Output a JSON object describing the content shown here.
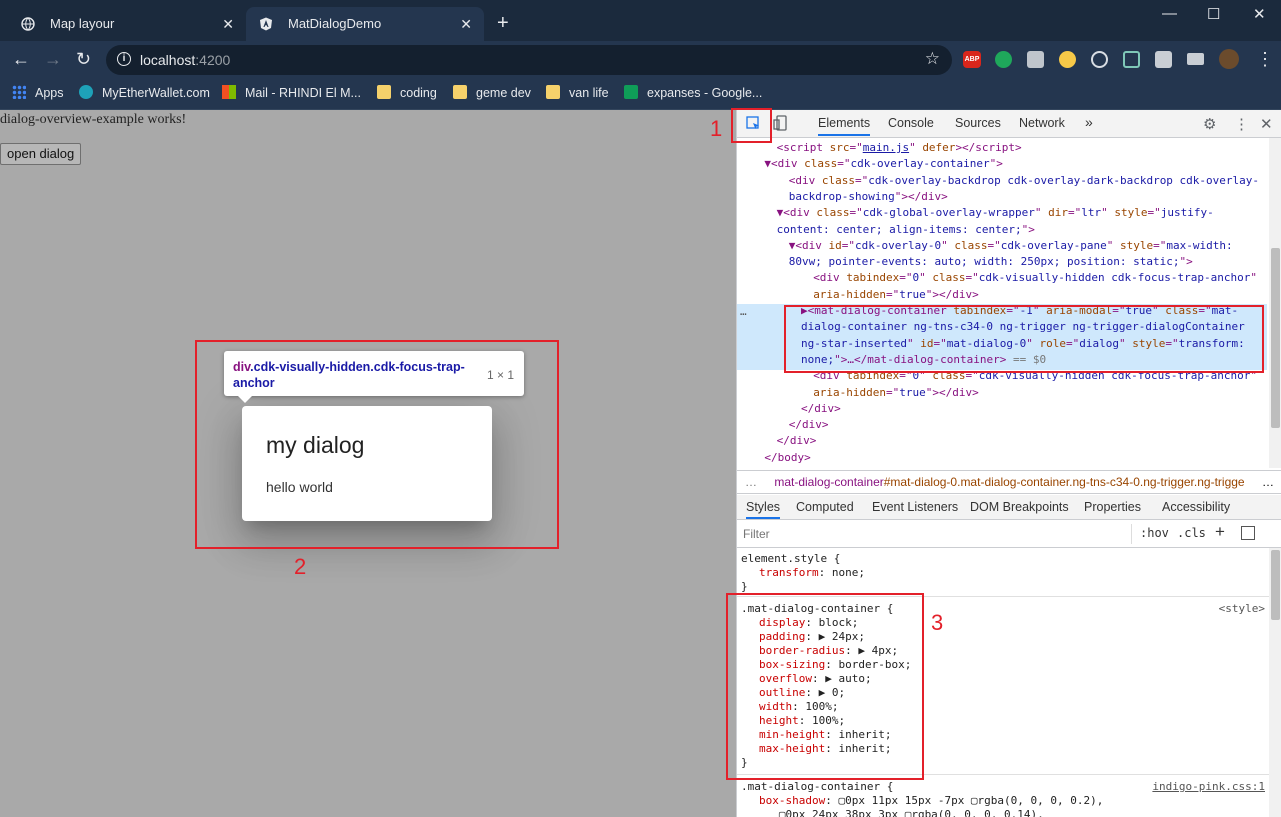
{
  "browser": {
    "tabs": [
      {
        "title": "Map layour",
        "close": "✕"
      },
      {
        "title": "MatDialogDemo",
        "close": "✕"
      }
    ],
    "new_tab": "+",
    "window_controls": {
      "minimize": "—",
      "maximize": "☐",
      "close": "✕"
    },
    "nav": {
      "back": "←",
      "forward": "→",
      "reload": "↻"
    },
    "url": {
      "host": "localhost",
      "port": ":4200"
    },
    "star": "☆",
    "extensions": [
      "adblock-plus",
      "green-leaf",
      "camera",
      "pacman",
      "target",
      "s-extension",
      "puzzle",
      "media",
      "avatar"
    ],
    "extension_label_abp": "ABP",
    "bookmarks": [
      {
        "label": "Apps",
        "icon": "apps-grid-icon"
      },
      {
        "label": "MyEtherWallet.com",
        "icon": "mew-icon"
      },
      {
        "label": "Mail - RHINDI El M...",
        "icon": "microsoft-icon"
      },
      {
        "label": "coding",
        "icon": "folder-icon"
      },
      {
        "label": "geme dev",
        "icon": "folder-icon"
      },
      {
        "label": "van life",
        "icon": "folder-icon"
      },
      {
        "label": "expanses - Google...",
        "icon": "sheets-icon"
      }
    ]
  },
  "page": {
    "works_text": "dialog-overview-example works!",
    "open_button": "open dialog",
    "tooltip": {
      "tag": "div",
      "classes": ".cdk-visually-hidden.cdk-focus-trap-anchor",
      "size": "1 × 1"
    },
    "dialog": {
      "title": "my dialog",
      "body": "hello world"
    }
  },
  "annotations": {
    "n1": "1",
    "n2": "2",
    "n3": "3",
    "color": "#e3202a"
  },
  "devtools": {
    "tabs": [
      "Elements",
      "Console",
      "Sources",
      "Network",
      "»"
    ],
    "dom": [
      {
        "indent": 3,
        "html": "<span class='tag'>&lt;script</span> <span class='an'>src</span>=\"<span class='lnk'>main.js</span>\" <span class='an'>defer</span><span class='tag'>&gt;&lt;/script&gt;</span>"
      },
      {
        "indent": 2,
        "html": "▼<span class='tag'>&lt;div</span> <span class='an'>class</span>=\"<span class='av'>cdk-overlay-container</span>\"<span class='tag'>&gt;</span>"
      },
      {
        "indent": 4,
        "html": "<span class='tag'>&lt;div</span> <span class='an'>class</span>=\"<span class='av'>cdk-overlay-backdrop cdk-overlay-dark-backdrop cdk-overlay-</span>"
      },
      {
        "indent": 4,
        "html": "<span class='av'>backdrop-showing</span>\"<span class='tag'>&gt;&lt;/div&gt;</span>"
      },
      {
        "indent": 3,
        "html": "▼<span class='tag'>&lt;div</span> <span class='an'>class</span>=\"<span class='av'>cdk-global-overlay-wrapper</span>\" <span class='an'>dir</span>=\"<span class='av'>ltr</span>\" <span class='an'>style</span>=\"<span class='av'>justify-</span>"
      },
      {
        "indent": 3,
        "html": "<span class='av'>content: center; align-items: center;</span>\"<span class='tag'>&gt;</span>"
      },
      {
        "indent": 4,
        "html": "▼<span class='tag'>&lt;div</span> <span class='an'>id</span>=\"<span class='av'>cdk-overlay-0</span>\" <span class='an'>class</span>=\"<span class='av'>cdk-overlay-pane</span>\" <span class='an'>style</span>=\"<span class='av'>max-width:</span>"
      },
      {
        "indent": 4,
        "html": "<span class='av'>80vw; pointer-events: auto; width: 250px; position: static;</span>\"<span class='tag'>&gt;</span>"
      },
      {
        "indent": 6,
        "html": "<span class='tag'>&lt;div</span> <span class='an'>tabindex</span>=\"<span class='av'>0</span>\" <span class='an'>class</span>=\"<span class='av'>cdk-visually-hidden cdk-focus-trap-anchor</span>\""
      },
      {
        "indent": 6,
        "html": "<span class='an'>aria-hidden</span>=\"<span class='av'>true</span>\"<span class='tag'>&gt;&lt;/div&gt;</span>"
      },
      {
        "indent": 5,
        "html": "▶<span class='tag'>&lt;mat-dialog-container</span> <span class='an'>tabindex</span>=\"<span class='av'>-1</span>\" <span class='an'>aria-modal</span>=\"<span class='av'>true</span>\" <span class='an'>class</span>=\"<span class='av'>mat-</span>"
      },
      {
        "indent": 5,
        "html": "<span class='av'>dialog-container ng-tns-c34-0 ng-trigger ng-trigger-dialogContainer</span>"
      },
      {
        "indent": 5,
        "html": "<span class='av'>ng-star-inserted</span>\" <span class='an'>id</span>=\"<span class='av'>mat-dialog-0</span>\" <span class='an'>role</span>=\"<span class='av'>dialog</span>\" <span class='an'>style</span>=\"<span class='av'>transform:</span>"
      },
      {
        "indent": 5,
        "html": "<span class='av'>none;</span>\"<span class='tag'>&gt;</span>…<span class='tag'>&lt;/mat-dialog-container&gt;</span> <span style='color:#777'>== $0</span>"
      },
      {
        "indent": 6,
        "html": "<span class='tag'>&lt;div</span> <span class='an'>tabindex</span>=\"<span class='av'>0</span>\" <span class='an'>class</span>=\"<span class='av'>cdk-visually-hidden cdk-focus-trap-anchor</span>\""
      },
      {
        "indent": 6,
        "html": "<span class='an'>aria-hidden</span>=\"<span class='av'>true</span>\"<span class='tag'>&gt;&lt;/div&gt;</span>"
      },
      {
        "indent": 5,
        "html": "<span class='tag'>&lt;/div&gt;</span>"
      },
      {
        "indent": 4,
        "html": "<span class='tag'>&lt;/div&gt;</span>"
      },
      {
        "indent": 3,
        "html": "<span class='tag'>&lt;/div&gt;</span>"
      },
      {
        "indent": 2,
        "html": "<span class='tag'>&lt;/body&gt;</span>"
      }
    ],
    "row_ellipsis": "…",
    "breadcrumb": {
      "dots": "…",
      "tag": "mat-dialog-container",
      "rest": "#mat-dialog-0.mat-dialog-container.ng-tns-c34-0.ng-trigger.ng-trigge",
      "more": "…"
    },
    "subtabs": [
      "Styles",
      "Computed",
      "Event Listeners",
      "DOM Breakpoints",
      "Properties",
      "Accessibility"
    ],
    "filter_placeholder": "Filter",
    "filter_tools": {
      "hov": ":hov",
      "cls": ".cls",
      "plus": "+"
    },
    "styles": {
      "element_style": {
        "selector": "element.style {",
        "props": [
          {
            "n": "transform",
            "v": "none;"
          }
        ],
        "close": "}"
      },
      "rule1": {
        "selector": ".mat-dialog-container {",
        "source": "<style>",
        "props": [
          {
            "n": "display",
            "v": "block;"
          },
          {
            "n": "padding",
            "v": "▶ 24px;"
          },
          {
            "n": "border-radius",
            "v": "▶ 4px;"
          },
          {
            "n": "box-sizing",
            "v": "border-box;"
          },
          {
            "n": "overflow",
            "v": "▶ auto;"
          },
          {
            "n": "outline",
            "v": "▶ 0;"
          },
          {
            "n": "width",
            "v": "100%;"
          },
          {
            "n": "height",
            "v": "100%;"
          },
          {
            "n": "min-height",
            "v": "inherit;"
          },
          {
            "n": "max-height",
            "v": "inherit;"
          }
        ],
        "close": "}"
      },
      "rule2": {
        "selector": ".mat-dialog-container {",
        "source": "indigo-pink.css:1",
        "props": [
          {
            "n": "box-shadow",
            "v": "▢0px 11px 15px -7px ▢rgba(0, 0, 0, 0.2),"
          },
          {
            "n": "",
            "v": "   ▢0px 24px 38px 3px ▢rgba(0, 0, 0, 0.14),"
          }
        ]
      }
    }
  }
}
